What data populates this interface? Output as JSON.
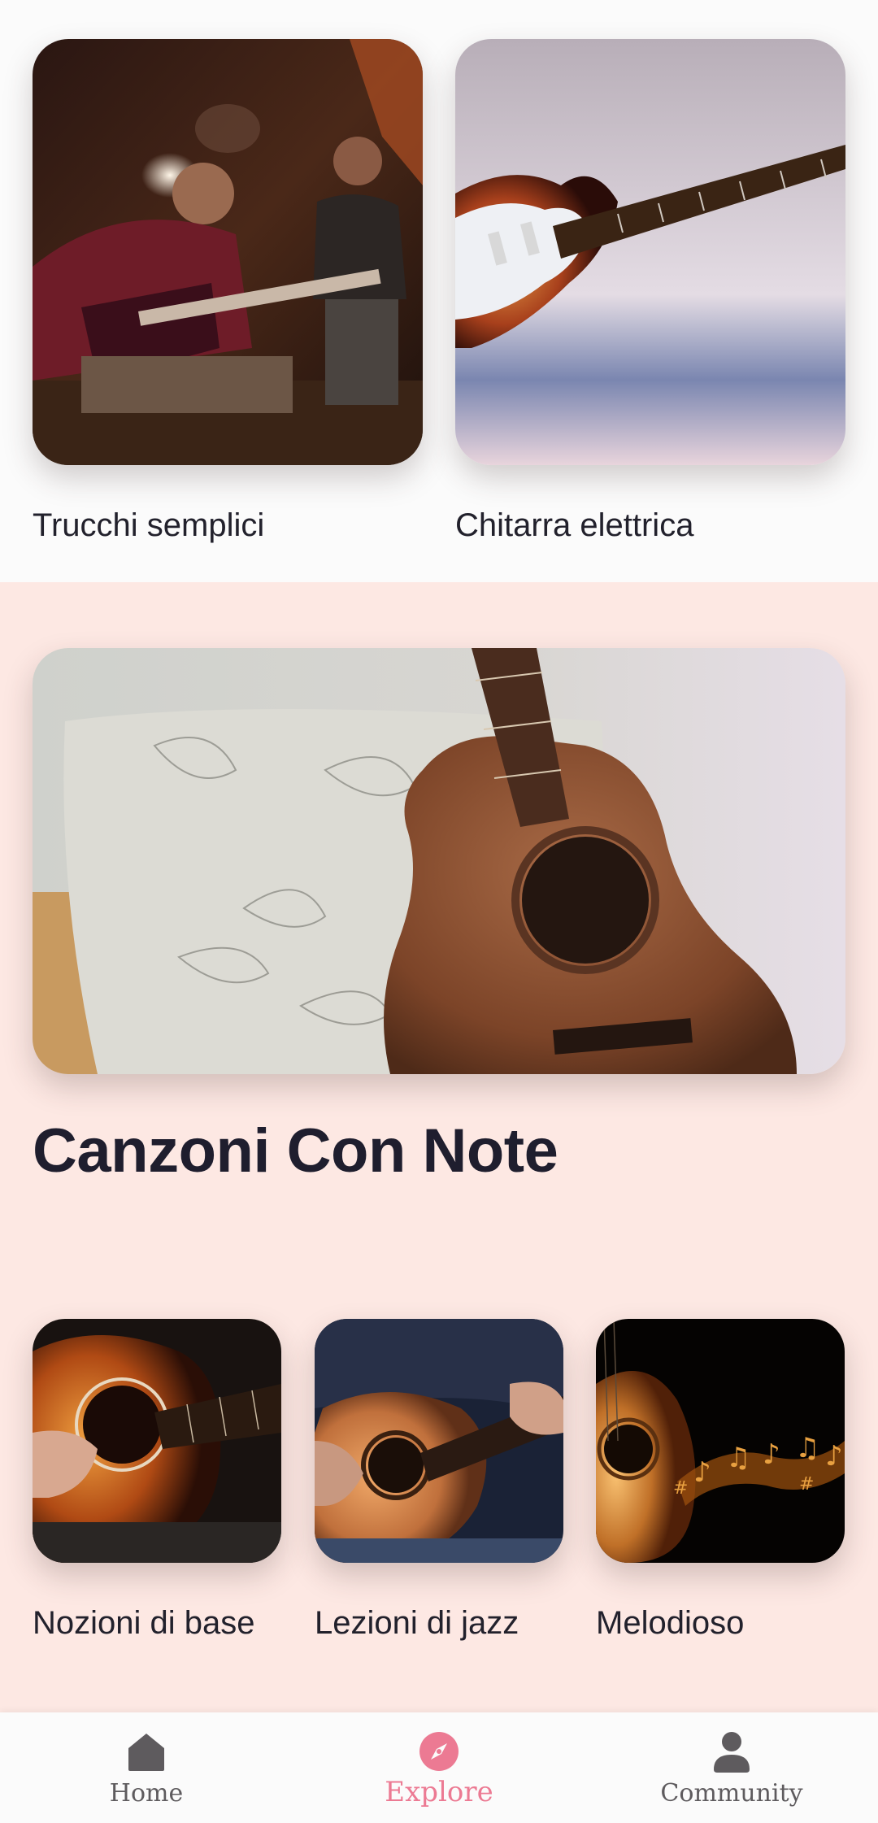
{
  "top_cards": [
    {
      "label": "Trucchi semplici",
      "image": "guitar-players-photo"
    },
    {
      "label": "Chitarra elettrica",
      "image": "electric-guitar-photo"
    }
  ],
  "featured": {
    "title": "Canzoni Con Note",
    "image": "acoustic-guitar-pillow-photo"
  },
  "small_cards": [
    {
      "label": "Nozioni di base",
      "image": "hands-on-guitar-photo"
    },
    {
      "label": "Lezioni di jazz",
      "image": "jazz-guitar-player-photo"
    },
    {
      "label": "Melodioso",
      "image": "guitar-music-notes-photo"
    }
  ],
  "nav": {
    "items": [
      {
        "label": "Home",
        "icon": "home-icon"
      },
      {
        "label": "Explore",
        "icon": "compass-icon"
      },
      {
        "label": "Community",
        "icon": "person-icon"
      }
    ],
    "active": "Explore"
  },
  "colors": {
    "accent": "#ec7a93",
    "pink_background": "#fde8e3",
    "text_dark": "#1f1e2e"
  }
}
